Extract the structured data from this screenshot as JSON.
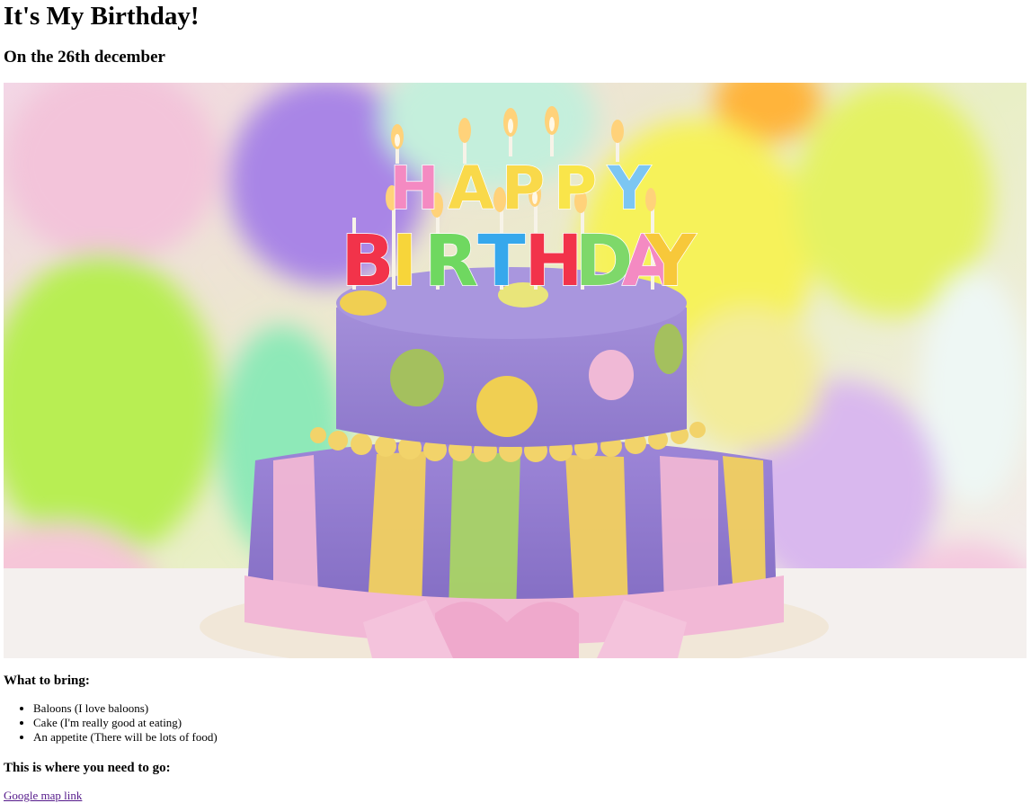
{
  "header": {
    "title": "It's My Birthday!",
    "date": "On the 26th december"
  },
  "hero_image": {
    "subject": "birthday cake with HAPPY BIRTHDAY candles and balloons",
    "candles_top": "HAPPY",
    "candles_bottom": "BIRTHDAY"
  },
  "bring": {
    "heading": "What to bring:",
    "items": [
      "Baloons (I love baloons)",
      "Cake (I'm really good at eating)",
      "An appetite (There will be lots of food)"
    ]
  },
  "location": {
    "heading": "This is where you need to go:",
    "link_label": "Google map link"
  },
  "colors": {
    "link": "#551a8b",
    "cake_purple": "#9a84d6",
    "icing_pink": "#f2b8d6"
  }
}
